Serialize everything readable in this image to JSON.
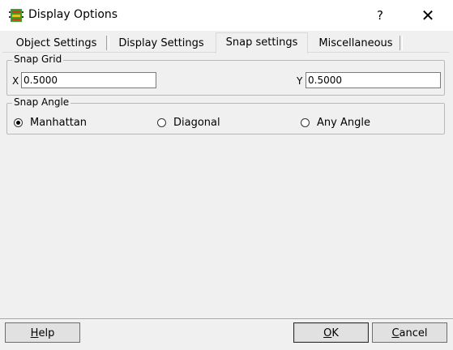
{
  "window": {
    "title": "Display Options",
    "help_glyph": "?",
    "close_glyph": "✕"
  },
  "tabs": [
    {
      "label": "Object Settings",
      "active": false
    },
    {
      "label": "Display Settings",
      "active": false
    },
    {
      "label": "Snap settings",
      "active": true
    },
    {
      "label": "Miscellaneous",
      "active": false
    }
  ],
  "snap_grid": {
    "label": "Snap Grid",
    "x_label": "X",
    "x_value": "0.5000",
    "y_label": "Y",
    "y_value": "0.5000"
  },
  "snap_angle": {
    "label": "Snap Angle",
    "options": [
      {
        "label": "Manhattan",
        "selected": true
      },
      {
        "label": "Diagonal",
        "selected": false
      },
      {
        "label": "Any Angle",
        "selected": false
      }
    ]
  },
  "buttons": {
    "help": {
      "first": "H",
      "rest": "elp"
    },
    "ok": {
      "first": "O",
      "rest": "K"
    },
    "cancel": {
      "first": "C",
      "rest": "ancel"
    }
  },
  "colors": {
    "icon_primary": "#e03a1e",
    "icon_secondary": "#3a9e2a"
  }
}
